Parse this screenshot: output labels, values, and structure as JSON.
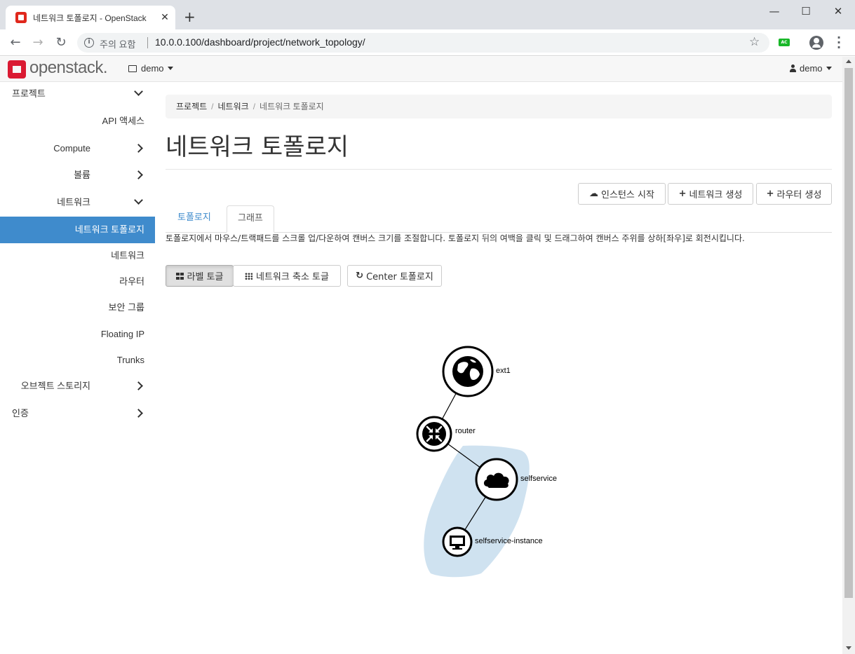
{
  "browser": {
    "tab_title": "네트워크 토폴로지 - OpenStack",
    "tab_close": "✕",
    "new_tab": "+",
    "security_label": "주의 요함",
    "url": "10.0.0.100/dashboard/project/network_topology/",
    "ext_badge": "AC",
    "window": {
      "minimize": "—",
      "maximize": "☐",
      "close": "✕"
    }
  },
  "header": {
    "logo_text": "openstack.",
    "project": "demo",
    "user": "demo"
  },
  "sidebar": {
    "items": [
      {
        "label": "프로젝트",
        "level": 0,
        "chevron": "down"
      },
      {
        "label": "API 액세스",
        "level": 2
      },
      {
        "label": "Compute",
        "level": 1,
        "chevron": "right"
      },
      {
        "label": "볼륨",
        "level": 1,
        "chevron": "right"
      },
      {
        "label": "네트워크",
        "level": 1,
        "chevron": "down"
      },
      {
        "label": "네트워크 토폴로지",
        "level": 2,
        "active": true
      },
      {
        "label": "네트워크",
        "level": 2
      },
      {
        "label": "라우터",
        "level": 2
      },
      {
        "label": "보안 그룹",
        "level": 2
      },
      {
        "label": "Floating IP",
        "level": 2
      },
      {
        "label": "Trunks",
        "level": 2
      },
      {
        "label": "오브젝트 스토리지",
        "level": 1,
        "chevron": "right"
      },
      {
        "label": "인증",
        "level": 0,
        "chevron": "right"
      }
    ],
    "active_color": "#3f8bcc"
  },
  "breadcrumb": [
    "프로젝트",
    "네트워크",
    "네트워크 토폴로지"
  ],
  "page": {
    "title": "네트워크 토폴로지",
    "actions": {
      "launch_instance": "인스턴스 시작",
      "create_network": "네트워크 생성",
      "create_router": "라우터 생성"
    },
    "tabs": {
      "topology": "토폴로지",
      "graph": "그래프"
    },
    "help": "토폴로지에서 마우스/트랙패드를 스크롤 업/다운하여 캔버스 크기를 조절합니다. 토폴로지 뒤의 여백을 클릭 및 드래그하여 캔버스 주위를 상하[좌우]로 회전시킵니다.",
    "controls": {
      "toggle_labels": "라벨 토글",
      "toggle_collapse": "네트워크 축소 토글",
      "center": "Center 토폴로지"
    }
  },
  "topology": {
    "nodes": [
      {
        "id": "ext1",
        "label": "ext1",
        "icon": "globe-icon"
      },
      {
        "id": "router",
        "label": "router",
        "icon": "router-icon"
      },
      {
        "id": "selfservice",
        "label": "selfservice",
        "icon": "cloud-icon"
      },
      {
        "id": "instance",
        "label": "selfservice-instance",
        "icon": "monitor-icon"
      }
    ],
    "group_color": "#cfe2f0"
  }
}
